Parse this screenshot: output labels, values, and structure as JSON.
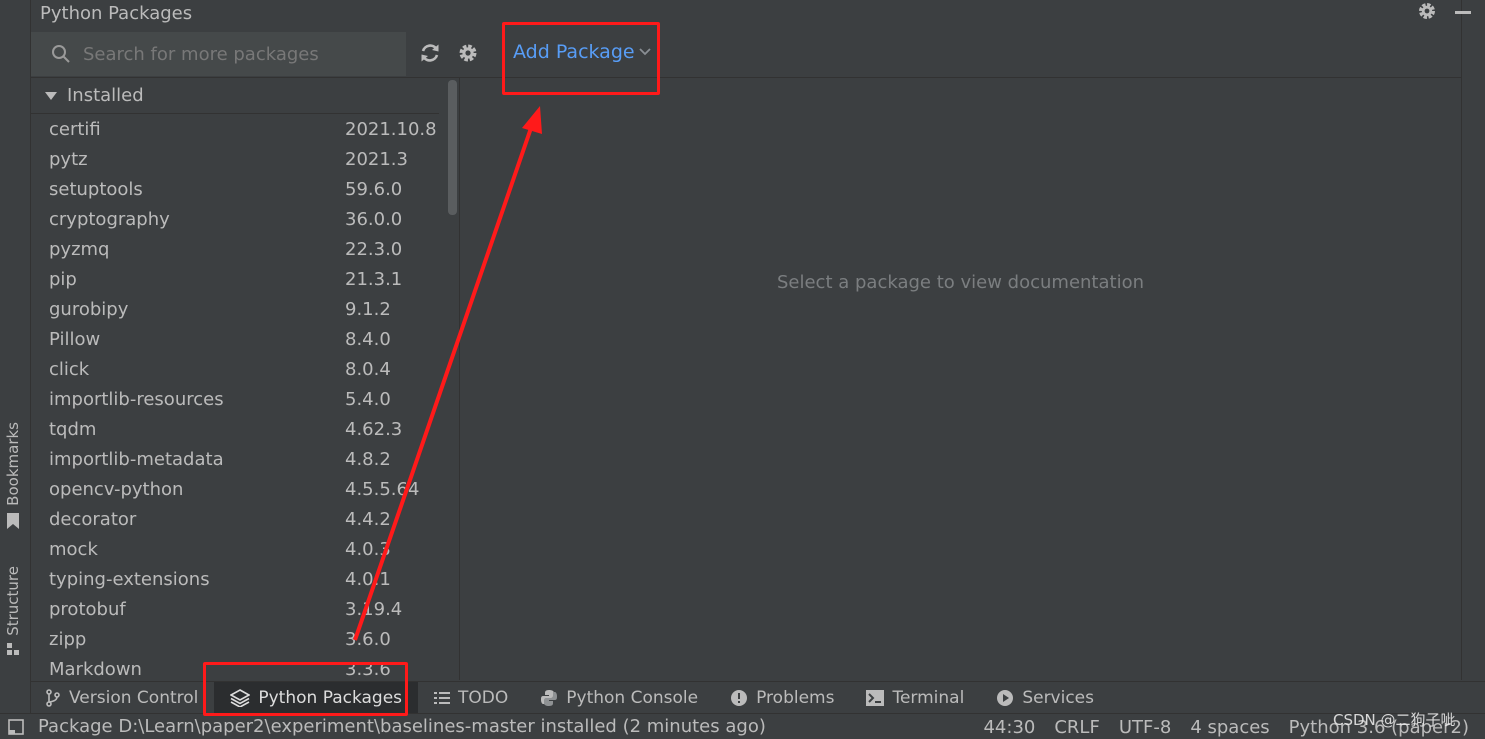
{
  "window": {
    "title": "Python Packages"
  },
  "search": {
    "placeholder": "Search for more packages"
  },
  "toolbar": {
    "add_package_label": "Add Package"
  },
  "installed_group": {
    "label": "Installed"
  },
  "packages": [
    {
      "name": "certifi",
      "version": "2021.10.8"
    },
    {
      "name": "pytz",
      "version": "2021.3"
    },
    {
      "name": "setuptools",
      "version": "59.6.0"
    },
    {
      "name": "cryptography",
      "version": "36.0.0"
    },
    {
      "name": "pyzmq",
      "version": "22.3.0"
    },
    {
      "name": "pip",
      "version": "21.3.1"
    },
    {
      "name": "gurobipy",
      "version": "9.1.2"
    },
    {
      "name": "Pillow",
      "version": "8.4.0"
    },
    {
      "name": "click",
      "version": "8.0.4"
    },
    {
      "name": "importlib-resources",
      "version": "5.4.0"
    },
    {
      "name": "tqdm",
      "version": "4.62.3"
    },
    {
      "name": "importlib-metadata",
      "version": "4.8.2"
    },
    {
      "name": "opencv-python",
      "version": "4.5.5.64"
    },
    {
      "name": "decorator",
      "version": "4.4.2"
    },
    {
      "name": "mock",
      "version": "4.0.3"
    },
    {
      "name": "typing-extensions",
      "version": "4.0.1"
    },
    {
      "name": "protobuf",
      "version": "3.19.4"
    },
    {
      "name": "zipp",
      "version": "3.6.0"
    },
    {
      "name": "Markdown",
      "version": "3.3.6"
    }
  ],
  "doc_pane": {
    "empty_message": "Select a package to view documentation"
  },
  "left_tool_tabs": {
    "bookmarks": "Bookmarks",
    "structure": "Structure"
  },
  "bottom_tabs": {
    "version_control": "Version Control",
    "python_packages": "Python Packages",
    "todo": "TODO",
    "python_console": "Python Console",
    "problems": "Problems",
    "terminal": "Terminal",
    "services": "Services"
  },
  "status_bar": {
    "message": "Package D:\\Learn\\paper2\\experiment\\baselines-master installed (2 minutes ago)",
    "position": "44:30",
    "line_separator": "CRLF",
    "encoding": "UTF-8",
    "indent": "4 spaces",
    "interpreter": "Python 3.6 (paper2)"
  },
  "watermark": {
    "text": "CSDN @二狗子呲"
  },
  "colors": {
    "accent": "#589df6",
    "highlight": "#ff1a1a",
    "background": "#3c3f41"
  }
}
